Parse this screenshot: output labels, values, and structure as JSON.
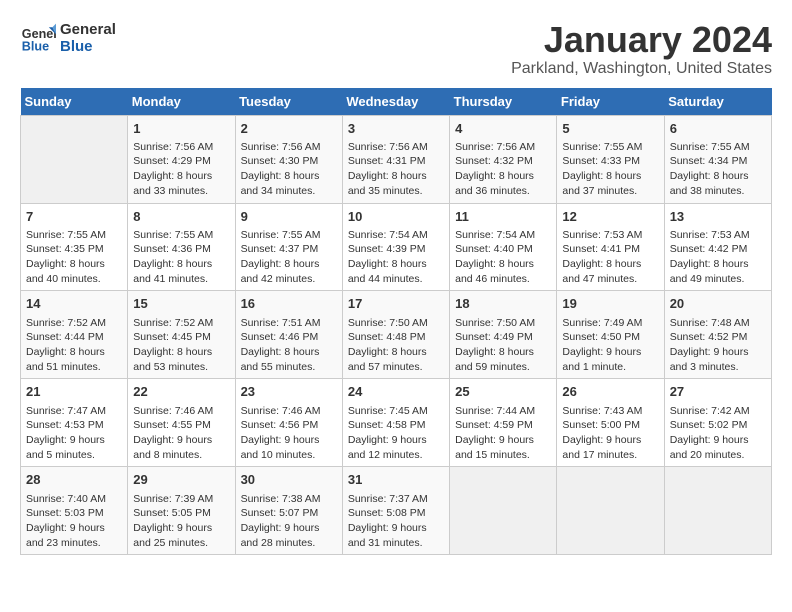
{
  "logo": {
    "line1": "General",
    "line2": "Blue"
  },
  "title": "January 2024",
  "location": "Parkland, Washington, United States",
  "days_of_week": [
    "Sunday",
    "Monday",
    "Tuesday",
    "Wednesday",
    "Thursday",
    "Friday",
    "Saturday"
  ],
  "weeks": [
    [
      {
        "day": "",
        "info": ""
      },
      {
        "day": "1",
        "info": "Sunrise: 7:56 AM\nSunset: 4:29 PM\nDaylight: 8 hours\nand 33 minutes."
      },
      {
        "day": "2",
        "info": "Sunrise: 7:56 AM\nSunset: 4:30 PM\nDaylight: 8 hours\nand 34 minutes."
      },
      {
        "day": "3",
        "info": "Sunrise: 7:56 AM\nSunset: 4:31 PM\nDaylight: 8 hours\nand 35 minutes."
      },
      {
        "day": "4",
        "info": "Sunrise: 7:56 AM\nSunset: 4:32 PM\nDaylight: 8 hours\nand 36 minutes."
      },
      {
        "day": "5",
        "info": "Sunrise: 7:55 AM\nSunset: 4:33 PM\nDaylight: 8 hours\nand 37 minutes."
      },
      {
        "day": "6",
        "info": "Sunrise: 7:55 AM\nSunset: 4:34 PM\nDaylight: 8 hours\nand 38 minutes."
      }
    ],
    [
      {
        "day": "7",
        "info": "Sunrise: 7:55 AM\nSunset: 4:35 PM\nDaylight: 8 hours\nand 40 minutes."
      },
      {
        "day": "8",
        "info": "Sunrise: 7:55 AM\nSunset: 4:36 PM\nDaylight: 8 hours\nand 41 minutes."
      },
      {
        "day": "9",
        "info": "Sunrise: 7:55 AM\nSunset: 4:37 PM\nDaylight: 8 hours\nand 42 minutes."
      },
      {
        "day": "10",
        "info": "Sunrise: 7:54 AM\nSunset: 4:39 PM\nDaylight: 8 hours\nand 44 minutes."
      },
      {
        "day": "11",
        "info": "Sunrise: 7:54 AM\nSunset: 4:40 PM\nDaylight: 8 hours\nand 46 minutes."
      },
      {
        "day": "12",
        "info": "Sunrise: 7:53 AM\nSunset: 4:41 PM\nDaylight: 8 hours\nand 47 minutes."
      },
      {
        "day": "13",
        "info": "Sunrise: 7:53 AM\nSunset: 4:42 PM\nDaylight: 8 hours\nand 49 minutes."
      }
    ],
    [
      {
        "day": "14",
        "info": "Sunrise: 7:52 AM\nSunset: 4:44 PM\nDaylight: 8 hours\nand 51 minutes."
      },
      {
        "day": "15",
        "info": "Sunrise: 7:52 AM\nSunset: 4:45 PM\nDaylight: 8 hours\nand 53 minutes."
      },
      {
        "day": "16",
        "info": "Sunrise: 7:51 AM\nSunset: 4:46 PM\nDaylight: 8 hours\nand 55 minutes."
      },
      {
        "day": "17",
        "info": "Sunrise: 7:50 AM\nSunset: 4:48 PM\nDaylight: 8 hours\nand 57 minutes."
      },
      {
        "day": "18",
        "info": "Sunrise: 7:50 AM\nSunset: 4:49 PM\nDaylight: 8 hours\nand 59 minutes."
      },
      {
        "day": "19",
        "info": "Sunrise: 7:49 AM\nSunset: 4:50 PM\nDaylight: 9 hours\nand 1 minute."
      },
      {
        "day": "20",
        "info": "Sunrise: 7:48 AM\nSunset: 4:52 PM\nDaylight: 9 hours\nand 3 minutes."
      }
    ],
    [
      {
        "day": "21",
        "info": "Sunrise: 7:47 AM\nSunset: 4:53 PM\nDaylight: 9 hours\nand 5 minutes."
      },
      {
        "day": "22",
        "info": "Sunrise: 7:46 AM\nSunset: 4:55 PM\nDaylight: 9 hours\nand 8 minutes."
      },
      {
        "day": "23",
        "info": "Sunrise: 7:46 AM\nSunset: 4:56 PM\nDaylight: 9 hours\nand 10 minutes."
      },
      {
        "day": "24",
        "info": "Sunrise: 7:45 AM\nSunset: 4:58 PM\nDaylight: 9 hours\nand 12 minutes."
      },
      {
        "day": "25",
        "info": "Sunrise: 7:44 AM\nSunset: 4:59 PM\nDaylight: 9 hours\nand 15 minutes."
      },
      {
        "day": "26",
        "info": "Sunrise: 7:43 AM\nSunset: 5:00 PM\nDaylight: 9 hours\nand 17 minutes."
      },
      {
        "day": "27",
        "info": "Sunrise: 7:42 AM\nSunset: 5:02 PM\nDaylight: 9 hours\nand 20 minutes."
      }
    ],
    [
      {
        "day": "28",
        "info": "Sunrise: 7:40 AM\nSunset: 5:03 PM\nDaylight: 9 hours\nand 23 minutes."
      },
      {
        "day": "29",
        "info": "Sunrise: 7:39 AM\nSunset: 5:05 PM\nDaylight: 9 hours\nand 25 minutes."
      },
      {
        "day": "30",
        "info": "Sunrise: 7:38 AM\nSunset: 5:07 PM\nDaylight: 9 hours\nand 28 minutes."
      },
      {
        "day": "31",
        "info": "Sunrise: 7:37 AM\nSunset: 5:08 PM\nDaylight: 9 hours\nand 31 minutes."
      },
      {
        "day": "",
        "info": ""
      },
      {
        "day": "",
        "info": ""
      },
      {
        "day": "",
        "info": ""
      }
    ]
  ]
}
